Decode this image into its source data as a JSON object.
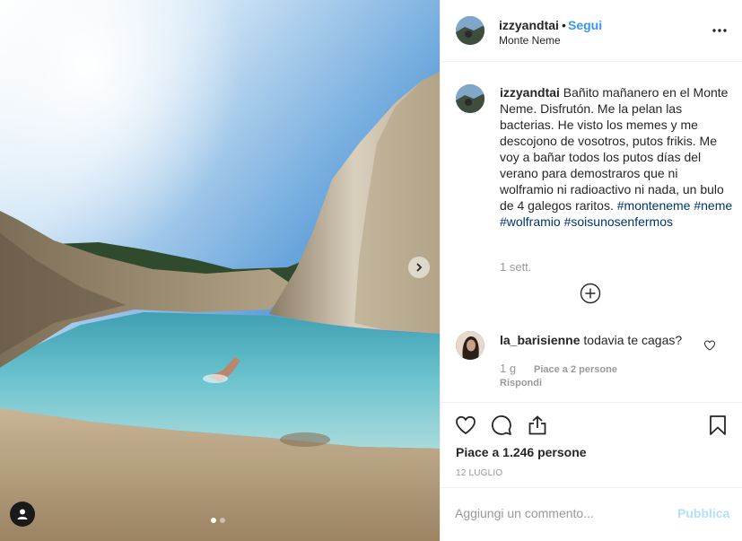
{
  "post": {
    "username": "izzyandtai",
    "separator": "•",
    "follow_label": "Segui",
    "location": "Monte Neme",
    "caption_text": "Bañito mañanero en el Monte Neme. Disfrutón. Me la pelan las bacterias. He visto los memes y me descojono de vosotros, putos frikis. Me voy a bañar todos los putos días del verano para demostraros que ni wolframio ni radioactivo ni nada, un bulo de 4 galegos raritos.",
    "hashtags": [
      "#monteneme",
      "#neme",
      "#wolframio",
      "#soisunosenfermos"
    ],
    "caption_time": "1 sett.",
    "likes_text": "Piace a 1.246 persone",
    "date": "12 LUGLIO"
  },
  "comments": [
    {
      "username": "la_barisienne",
      "text": "todavia te cagas?",
      "time": "1 g",
      "likes_text": "Piace a 2 persone",
      "reply_label": "Rispondi"
    }
  ],
  "composer": {
    "placeholder": "Aggiungi un commento...",
    "publish_label": "Pubblica"
  },
  "carousel": {
    "slide_count": 2,
    "active_index": 0
  },
  "icons": {
    "more": "more-options-icon",
    "load_more": "plus-circle-icon",
    "like": "heart-icon",
    "comment": "comment-icon",
    "share": "share-icon",
    "save": "bookmark-icon",
    "next": "chevron-right-icon",
    "tags": "user-tag-icon"
  },
  "colors": {
    "link": "#3897f0",
    "hashtag": "#003569",
    "muted": "#999999",
    "publish_disabled": "#b2dffc"
  }
}
